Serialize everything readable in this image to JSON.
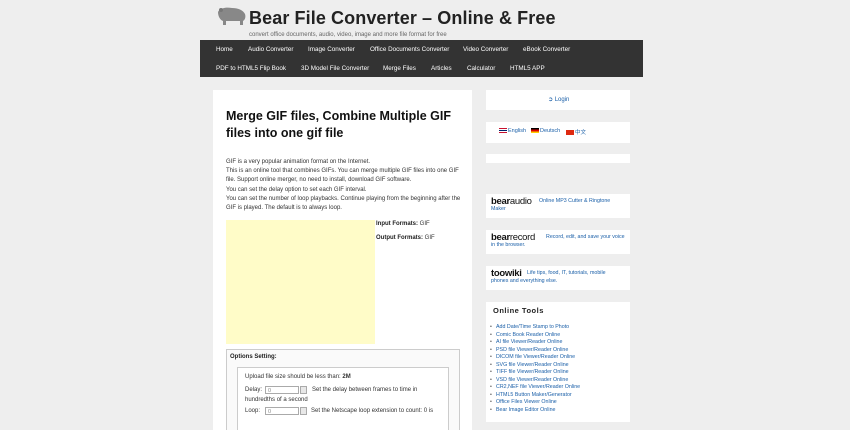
{
  "header": {
    "title": "Bear File Converter – Online & Free",
    "tagline": "convert office documents, audio, video, image and more file format for free"
  },
  "nav": {
    "row1": [
      "Home",
      "Audio Converter",
      "Image Converter",
      "Office Documents Converter",
      "Video Converter",
      "eBook Converter"
    ],
    "row2": [
      "PDF to HTML5 Flip Book",
      "3D Model File Converter",
      "Merge Files",
      "Articles",
      "Calculator",
      "HTML5 APP"
    ]
  },
  "main": {
    "title": "Merge GIF files, Combine Multiple GIF files into one gif file",
    "description": [
      "GIF is a very popular animation format on the Internet.",
      "This is an online tool that combines GIFs. You can merge multiple GIF files into one GIF file. Support online merger, no need to install, download GIF software.",
      "You can set the delay option to set each GIF interval.",
      "You can set the number of loop playbacks. Continue playing from the beginning after the GIF is played. The default is to always loop."
    ],
    "input_formats_label": "Input Formats:",
    "input_formats_value": "GIF",
    "output_formats_label": "Output Formats:",
    "output_formats_value": "GIF",
    "options_title": "Options Setting:",
    "upload_limit_label": "Upload file size should be less than:",
    "upload_limit_value": "2M",
    "delay_label": "Delay:",
    "delay_value": "0",
    "delay_hint_1": "Set the delay between frames to time in",
    "delay_hint_2": "hundredths of a second",
    "loop_label": "Loop:",
    "loop_value": "0",
    "loop_hint": "Set the Netscape loop extension to count: 0 is"
  },
  "sidebar": {
    "login": "Login",
    "languages": [
      "English",
      "Deutsch",
      "中文"
    ],
    "bearaudio": {
      "logo_a": "bear",
      "logo_b": "audio",
      "text": "Online MP3 Cutter & Ringtone Maker"
    },
    "bearrecord": {
      "logo_a": "bear",
      "logo_b": "record",
      "text": "Record, edit, and save your voice in the browser."
    },
    "toowiki": {
      "logo": "toowiki",
      "text": "Life tips, food, IT, tutorials, mobile phones and everything else."
    },
    "tools_title": "Online Tools",
    "tools": [
      "Add Date/Time Stamp to Photo",
      "Comic Book Reader Online",
      "AI file Viewer/Reader Online",
      "PSD file Viewer/Reader Online",
      "DICOM file Viewer/Reader Online",
      "SVG file Viewer/Reader Online",
      "TIFF file Viewer/Reader Online",
      "VSD file Viewer/Reader Online",
      "CR2,NEF file Viewer/Reader Online",
      "HTML5 Button Maker/Generator",
      "Office Files Viewer Online",
      "Bear Image Editor Online"
    ]
  }
}
